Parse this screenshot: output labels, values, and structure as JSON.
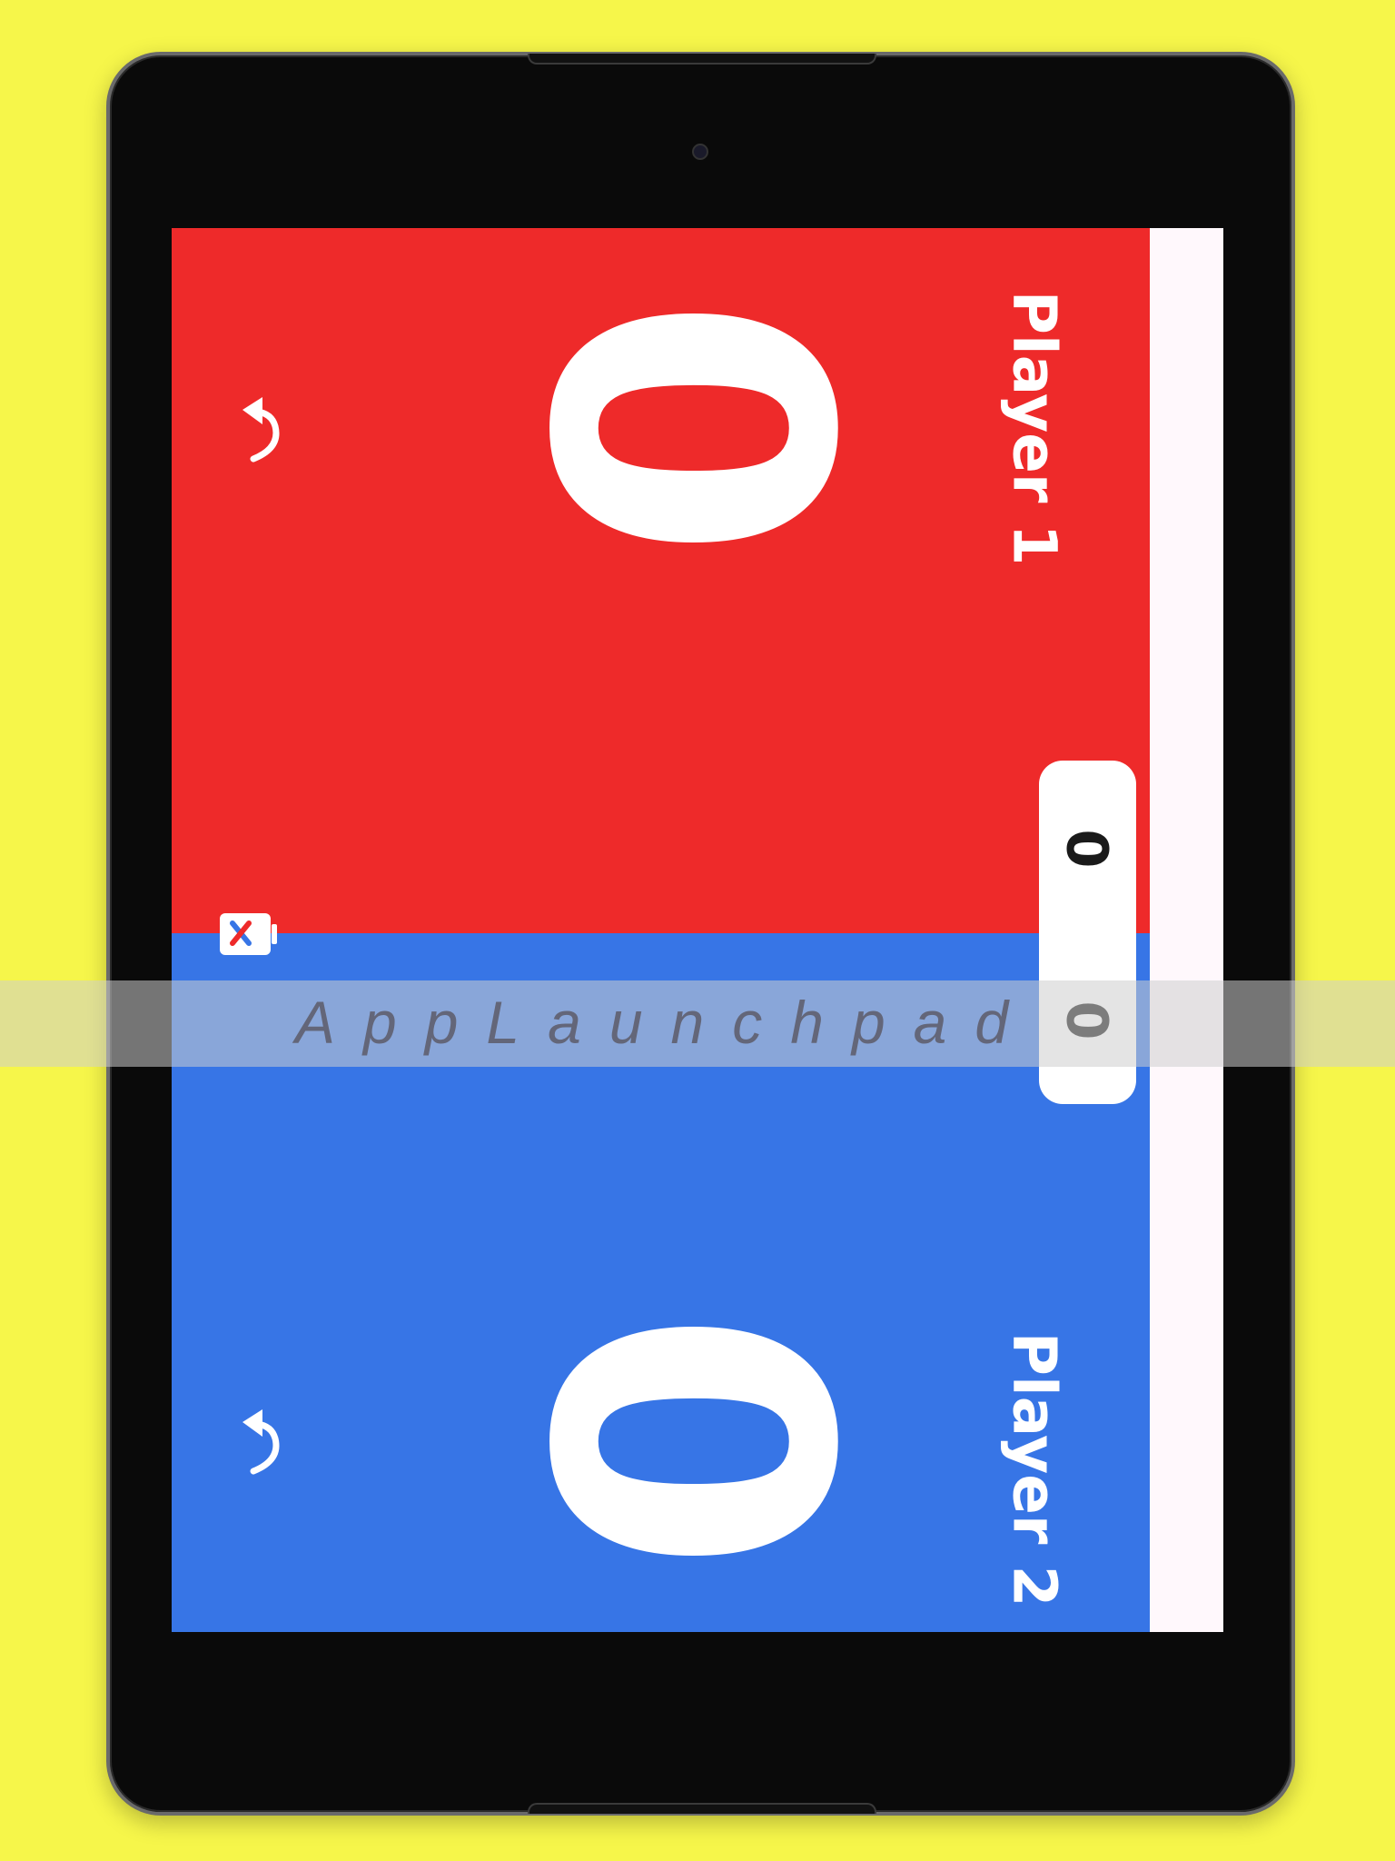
{
  "colors": {
    "background": "#F6F64A",
    "player1": "#EE2A2A",
    "player2": "#3775E6",
    "side_strip": "#FFF8FC"
  },
  "players": [
    {
      "name": "Player 1",
      "score": "0",
      "icon": "undo-icon"
    },
    {
      "name": "Player 2",
      "score": "0",
      "icon": "undo-icon"
    }
  ],
  "set_counter": {
    "player1": "0",
    "player2": "0"
  },
  "reset_icon": "reset-icon",
  "watermark": "AppLaunchpad"
}
